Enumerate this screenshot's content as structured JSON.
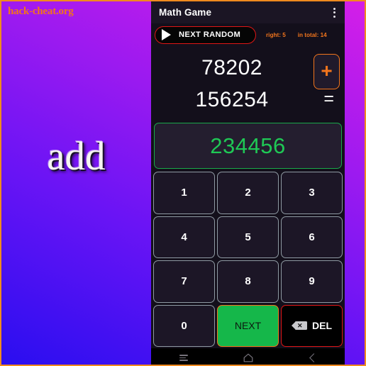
{
  "promo": {
    "watermark": "hack-cheat.org",
    "word": "add"
  },
  "app": {
    "title": "Math Game",
    "menu_icon": "overflow-menu-icon"
  },
  "toolbar": {
    "next_random_label": "NEXT RANDOM",
    "play_icon": "play-icon",
    "score_right": "right: 5",
    "score_total": "in total: 14"
  },
  "problem": {
    "operand_a": "78202",
    "operand_b": "156254",
    "operator": "+",
    "equals": "=",
    "answer": "234456"
  },
  "keypad": {
    "keys": [
      {
        "label": "1",
        "name": "key-1",
        "type": "digit"
      },
      {
        "label": "2",
        "name": "key-2",
        "type": "digit"
      },
      {
        "label": "3",
        "name": "key-3",
        "type": "digit"
      },
      {
        "label": "4",
        "name": "key-4",
        "type": "digit"
      },
      {
        "label": "5",
        "name": "key-5",
        "type": "digit"
      },
      {
        "label": "6",
        "name": "key-6",
        "type": "digit"
      },
      {
        "label": "7",
        "name": "key-7",
        "type": "digit"
      },
      {
        "label": "8",
        "name": "key-8",
        "type": "digit"
      },
      {
        "label": "9",
        "name": "key-9",
        "type": "digit"
      },
      {
        "label": "0",
        "name": "key-0",
        "type": "digit"
      }
    ],
    "next_label": "NEXT",
    "del_label": "DEL",
    "del_icon": "backspace-icon"
  },
  "navbar": {
    "recents_icon": "recents-icon",
    "home_icon": "home-icon",
    "back_icon": "back-icon"
  },
  "colors": {
    "accent_orange": "#f2751c",
    "danger_red": "#e01616",
    "success_green": "#1fc855",
    "next_green": "#15b74a",
    "app_bg": "#130f1b"
  }
}
